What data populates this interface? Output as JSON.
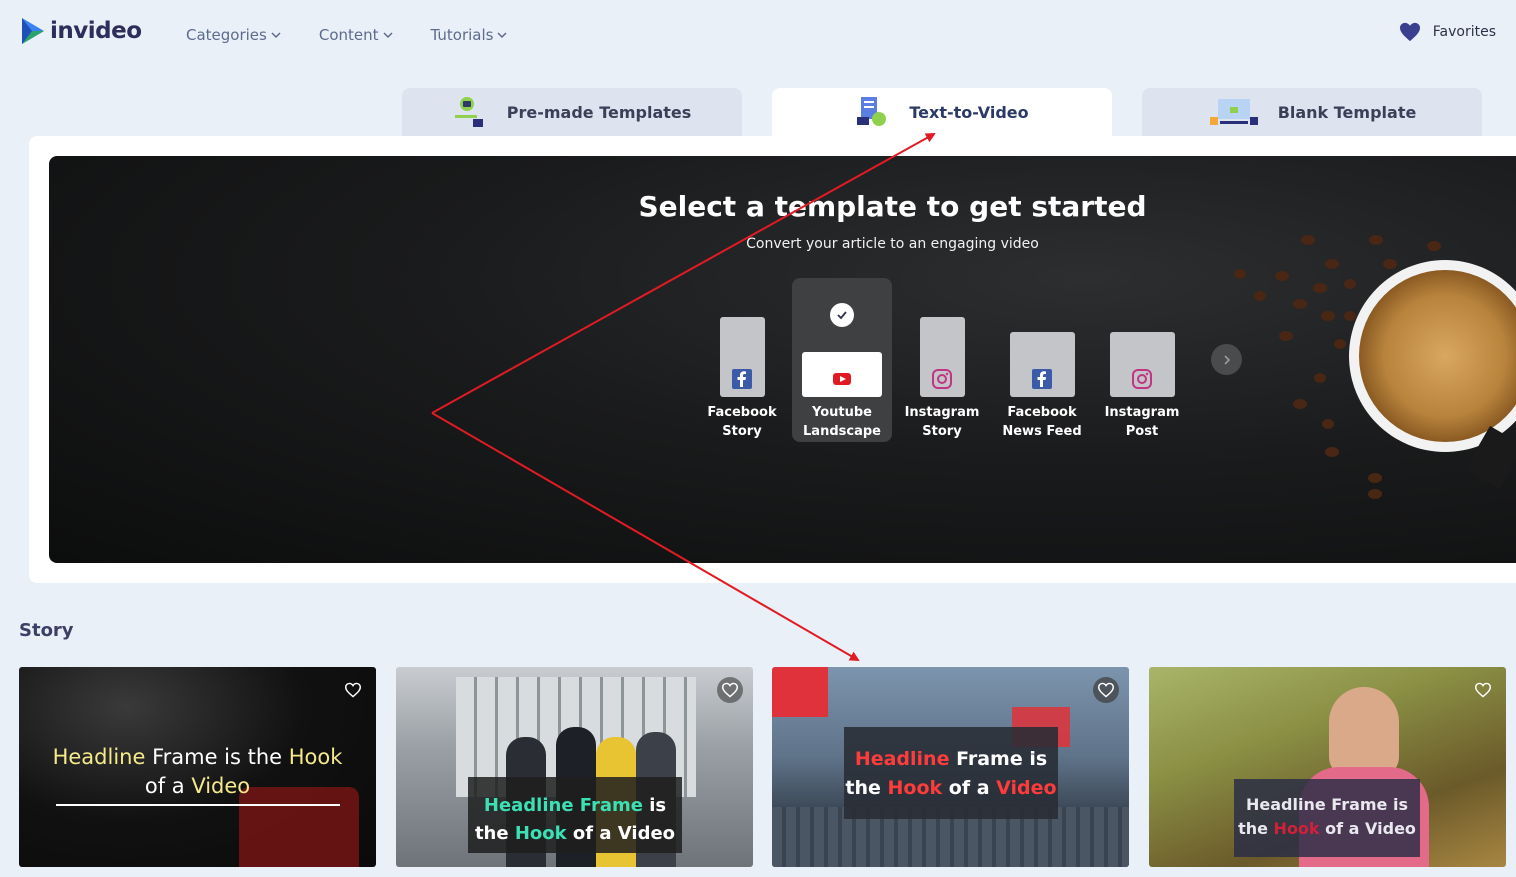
{
  "header": {
    "brand": "invideo",
    "nav": [
      {
        "label": "Categories"
      },
      {
        "label": "Content"
      },
      {
        "label": "Tutorials"
      }
    ],
    "favorites_label": "Favorites"
  },
  "tabs": [
    {
      "label": "Pre-made Templates",
      "active": false
    },
    {
      "label": "Text-to-Video",
      "active": true
    },
    {
      "label": "Blank Template",
      "active": false
    }
  ],
  "hero": {
    "title": "Select a template to get started",
    "subtitle": "Convert your article to an engaging video",
    "formats": [
      {
        "line1": "Facebook",
        "line2": "Story",
        "icon": "facebook-icon",
        "selected": false
      },
      {
        "line1": "Youtube",
        "line2": "Landscape",
        "icon": "youtube-icon",
        "selected": true
      },
      {
        "line1": "Instagram",
        "line2": "Story",
        "icon": "instagram-icon",
        "selected": false
      },
      {
        "line1": "Facebook",
        "line2": "News Feed",
        "icon": "facebook-icon",
        "selected": false
      },
      {
        "line1": "Instagram",
        "line2": "Post",
        "icon": "instagram-icon",
        "selected": false
      }
    ]
  },
  "story": {
    "title": "Story",
    "cards": [
      {
        "line1_a": "Headline",
        "line1_b": " Frame is the ",
        "line1_c": "Hook",
        "line2_a": "of a ",
        "line2_b": "Video",
        "accent": "#f5e98a"
      },
      {
        "line1_a": "Headline Frame",
        "line1_b": " is",
        "line2_a": "the ",
        "line2_b": "Hook",
        "line2_c": " of a Video",
        "accent": "#3be0b4"
      },
      {
        "line1_a": "Headline",
        "line1_b": " Frame is",
        "line2_a": "the ",
        "line2_b": "Hook",
        "line2_c": " of a ",
        "line2_d": "Video",
        "accent": "#ff3b3b"
      },
      {
        "line1_a": "Headline Frame is",
        "line2_a": "the ",
        "line2_b": "Hook",
        "line2_c": " of a Video",
        "accent": "#d0203a"
      }
    ]
  },
  "colors": {
    "accent_red": "#e01b24",
    "background": "#eaf0f8"
  }
}
